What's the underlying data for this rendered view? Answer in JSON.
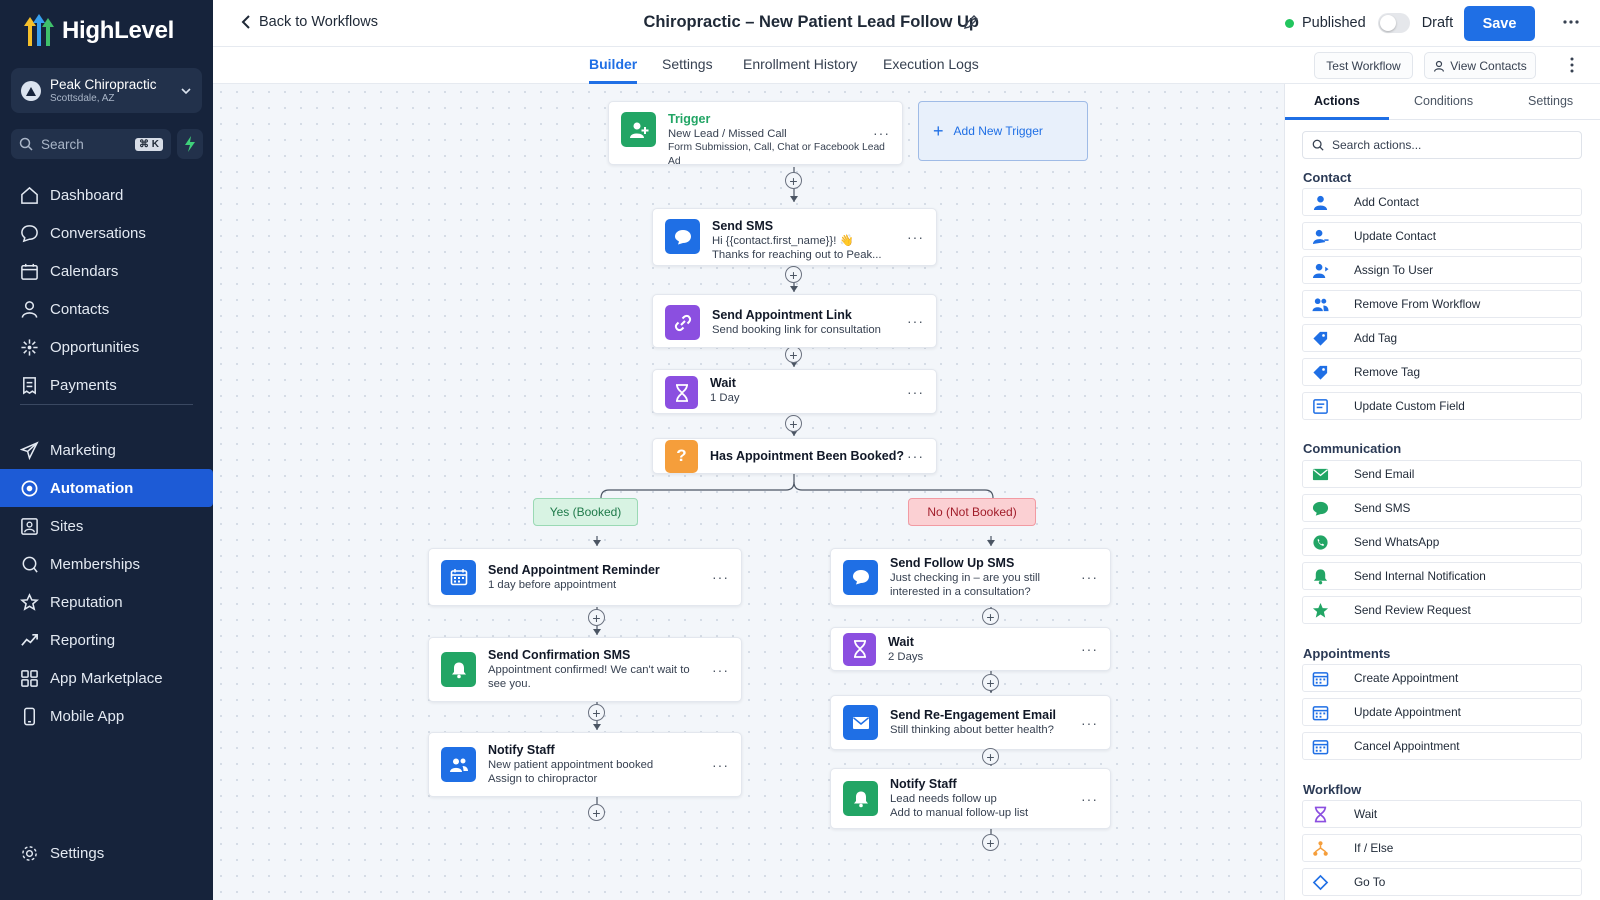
{
  "app": {
    "brand": "HighLevel"
  },
  "account": {
    "name": "Peak Chiropractic",
    "location": "Scottsdale, AZ"
  },
  "search": {
    "placeholder": "Search",
    "shortcut": "⌘ K"
  },
  "nav": {
    "primary": [
      {
        "label": "Dashboard",
        "icon": "home-icon"
      },
      {
        "label": "Conversations",
        "icon": "chat-icon"
      },
      {
        "label": "Calendars",
        "icon": "calendar-icon"
      },
      {
        "label": "Contacts",
        "icon": "user-icon"
      },
      {
        "label": "Opportunities",
        "icon": "opportunities-icon"
      },
      {
        "label": "Payments",
        "icon": "receipt-icon"
      }
    ],
    "secondary": [
      {
        "label": "Marketing",
        "icon": "send-icon"
      },
      {
        "label": "Automation",
        "icon": "automation-icon",
        "active": true
      },
      {
        "label": "Sites",
        "icon": "sites-icon"
      },
      {
        "label": "Memberships",
        "icon": "memberships-icon"
      },
      {
        "label": "Reputation",
        "icon": "star-icon"
      },
      {
        "label": "Reporting",
        "icon": "trend-icon"
      },
      {
        "label": "App Marketplace",
        "icon": "grid-icon"
      },
      {
        "label": "Mobile App",
        "icon": "phone-icon"
      }
    ],
    "settings": "Settings"
  },
  "header": {
    "back": "Back to Workflows",
    "title": "Chiropractic – New Patient Lead Follow Up",
    "published": "Published",
    "draft": "Draft",
    "save": "Save"
  },
  "tabs": {
    "items": [
      "Builder",
      "Settings",
      "Enrollment History",
      "Execution Logs"
    ],
    "active": "Builder",
    "test_workflow": "Test Workflow",
    "view_contacts": "View Contacts"
  },
  "workflow": {
    "trigger": {
      "title": "Trigger",
      "line1": "New Lead / Missed Call",
      "line2": "Form Submission, Call, Chat or Facebook Lead Ad"
    },
    "add_trigger": "Add New Trigger",
    "main": [
      {
        "title": "Send SMS",
        "lines": [
          "Hi {{contact.first_name}}! 👋",
          "Thanks for reaching out to Peak..."
        ]
      },
      {
        "title": "Send Appointment Link",
        "lines": [
          "Send booking link for consultation"
        ]
      },
      {
        "title": "Wait",
        "lines": [
          "1 Day"
        ]
      },
      {
        "title": "Has Appointment Been Booked?",
        "lines": []
      }
    ],
    "branch_yes": "Yes (Booked)",
    "branch_no": "No (Not Booked)",
    "yes_steps": [
      {
        "title": "Send Appointment Reminder",
        "lines": [
          "1 day before appointment"
        ]
      },
      {
        "title": "Send Confirmation SMS",
        "lines": [
          "Appointment confirmed! We can't wait to",
          "see you."
        ]
      },
      {
        "title": "Notify Staff",
        "lines": [
          "New patient appointment booked",
          "Assign to chiropractor"
        ]
      }
    ],
    "no_steps": [
      {
        "title": "Send Follow Up SMS",
        "lines": [
          "Just checking in – are you still",
          "interested in a consultation?"
        ]
      },
      {
        "title": "Wait",
        "lines": [
          "2 Days"
        ]
      },
      {
        "title": "Send Re-Engagement Email",
        "lines": [
          "Still thinking about better health?"
        ]
      },
      {
        "title": "Notify Staff",
        "lines": [
          "Lead needs follow up",
          "Add to manual follow-up list"
        ]
      }
    ],
    "more": "···",
    "plus": "+"
  },
  "panel": {
    "tabs": [
      "Actions",
      "Conditions",
      "Settings"
    ],
    "search_placeholder": "Search actions...",
    "sections": [
      {
        "title": "Contact",
        "items": [
          "Add Contact",
          "Update Contact",
          "Assign To User",
          "Remove From Workflow",
          "Add Tag",
          "Remove Tag",
          "Update Custom Field"
        ]
      },
      {
        "title": "Communication",
        "items": [
          "Send Email",
          "Send SMS",
          "Send WhatsApp",
          "Send Internal Notification",
          "Send Review Request"
        ]
      },
      {
        "title": "Appointments",
        "items": [
          "Create Appointment",
          "Update Appointment",
          "Cancel Appointment"
        ]
      },
      {
        "title": "Workflow",
        "items": [
          "Wait",
          "If / Else",
          "Go To"
        ]
      }
    ]
  },
  "colors": {
    "accent": "#1f6fe5",
    "sidebar": "#16233b",
    "green": "#22a565",
    "purple": "#8b4fe0",
    "orange": "#f59e3b",
    "yes_bg": "#d8f3e3",
    "no_bg": "#fbd0d3"
  }
}
